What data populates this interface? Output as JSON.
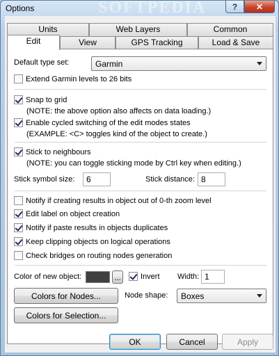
{
  "window": {
    "title": "Options",
    "watermark": "SOFTPEDIA",
    "help_label": "?",
    "close_label": "✕"
  },
  "tabs_row1": [
    {
      "label": "Units"
    },
    {
      "label": "Web Layers"
    },
    {
      "label": "Common"
    }
  ],
  "tabs_row2": [
    {
      "label": "Edit",
      "active": true
    },
    {
      "label": "View"
    },
    {
      "label": "GPS Tracking"
    },
    {
      "label": "Load & Save"
    }
  ],
  "edit": {
    "default_type_label": "Default type set:",
    "default_type_value": "Garmin",
    "extend_label": "Extend Garmin levels to 26 bits",
    "extend_checked": false,
    "snap_label": "Snap to grid",
    "snap_checked": true,
    "snap_note": "(NOTE: the above option also affects on data loading.)",
    "cycled_label": "Enable cycled switching of the edit modes states",
    "cycled_checked": true,
    "cycled_note": "(EXAMPLE: <C> toggles kind of the object to create.)",
    "stick_label": "Stick to neighbours",
    "stick_checked": true,
    "stick_note": "(NOTE: you can toggle sticking mode by Ctrl key when editing.)",
    "stick_symbol_label": "Stick symbol size:",
    "stick_symbol_value": "6",
    "stick_distance_label": "Stick distance:",
    "stick_distance_value": "8",
    "notify_zoom_label": "Notify if creating results in object out of 0-th zoom level",
    "notify_zoom_checked": false,
    "edit_label_label": "Edit label on object creation",
    "edit_label_checked": true,
    "notify_paste_label": "Notify if paste results in objects duplicates",
    "notify_paste_checked": true,
    "keep_clipping_label": "Keep clipping objects on logical operations",
    "keep_clipping_checked": true,
    "check_bridges_label": "Check bridges on routing nodes generation",
    "check_bridges_checked": false,
    "color_new_label": "Color of new object:",
    "color_new_value": "#404040",
    "color_browse_label": "...",
    "invert_label": "Invert",
    "invert_checked": true,
    "width_label": "Width:",
    "width_value": "1",
    "colors_nodes_label": "Colors for Nodes...",
    "node_shape_label": "Node shape:",
    "node_shape_value": "Boxes",
    "colors_selection_label": "Colors for Selection..."
  },
  "footer": {
    "ok_label": "OK",
    "cancel_label": "Cancel",
    "apply_label": "Apply"
  }
}
